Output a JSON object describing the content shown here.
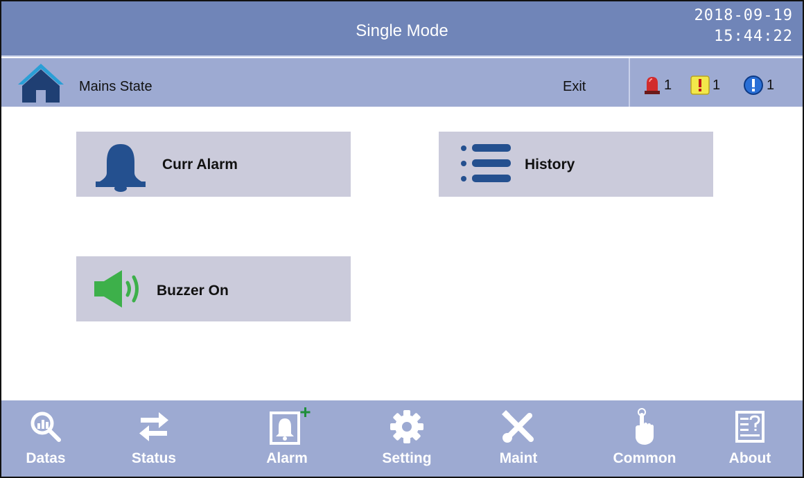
{
  "header": {
    "title": "Single Mode",
    "date": "2018-09-19",
    "time": "15:44:22"
  },
  "subbar": {
    "title": "Mains State",
    "exit_label": "Exit",
    "badges": [
      {
        "icon": "red-alarm-light-icon",
        "count": "1"
      },
      {
        "icon": "yellow-warning-icon",
        "count": "1"
      },
      {
        "icon": "blue-info-icon",
        "count": "1"
      }
    ]
  },
  "main": {
    "buttons": [
      {
        "label": "Curr Alarm",
        "icon": "bell-icon"
      },
      {
        "label": "History",
        "icon": "list-icon"
      },
      {
        "label": "Buzzer On",
        "icon": "speaker-icon"
      }
    ]
  },
  "nav": {
    "items": [
      {
        "label": "Datas",
        "icon": "chart-magnifier-icon"
      },
      {
        "label": "Status",
        "icon": "swap-arrows-icon"
      },
      {
        "label": "Alarm",
        "icon": "alarm-bell-icon"
      },
      {
        "label": "Setting",
        "icon": "gear-icon"
      },
      {
        "label": "Maint",
        "icon": "wrench-screwdriver-icon"
      },
      {
        "label": "Common",
        "icon": "pointer-hand-icon"
      },
      {
        "label": "About",
        "icon": "help-document-icon"
      }
    ]
  },
  "colors": {
    "title_bar": "#7085b8",
    "sub_bar": "#9daad2",
    "button_bg": "#cbcbdb",
    "icon_blue": "#24508f",
    "speaker_green": "#3db04a"
  }
}
